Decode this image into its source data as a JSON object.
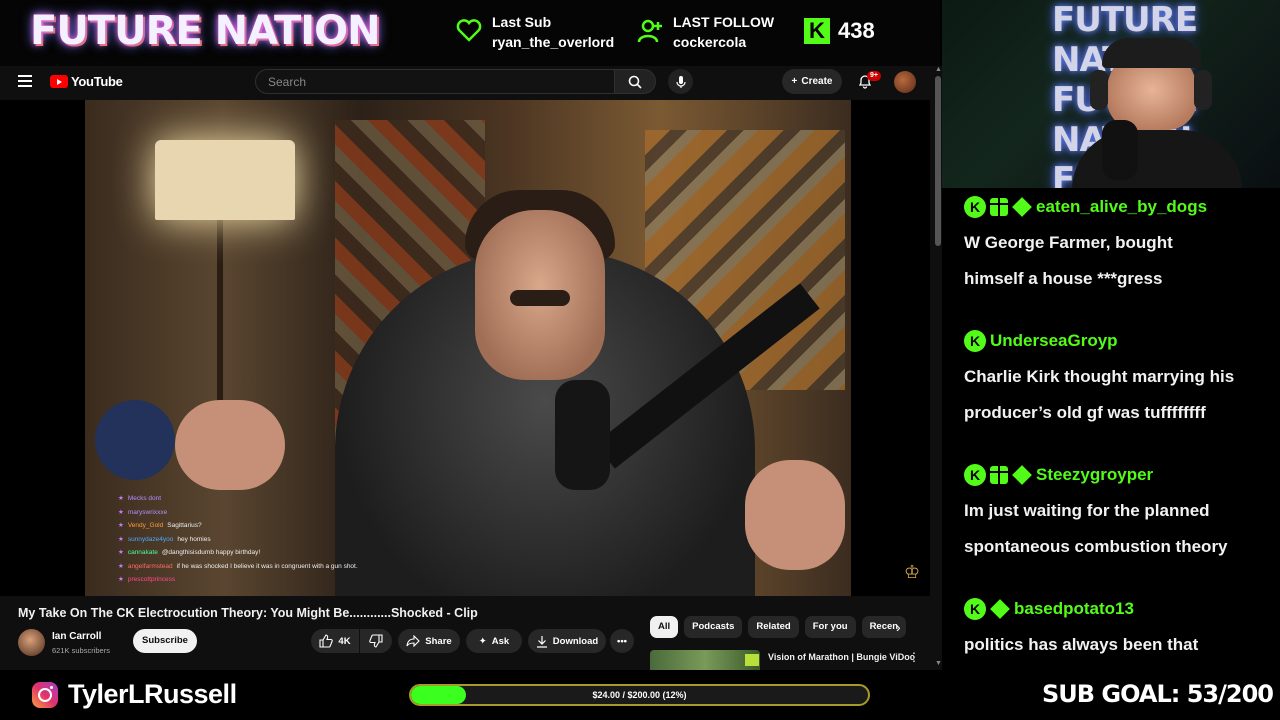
{
  "overlay": {
    "brand": "FUTURE NATION",
    "last_sub_label": "Last Sub",
    "last_sub_user": "ryan_the_overlord",
    "last_follow_label": "LAST FOLLOW",
    "last_follow_user": "cockercola",
    "kick_count": "438",
    "accent_color": "#53fc18"
  },
  "youtube": {
    "logo_text": "YouTube",
    "search_placeholder": "Search",
    "create_label": "Create",
    "notification_badge": "9+",
    "video_title": "My Take On The CK Electrocution Theory: You Might Be............Shocked - Clip",
    "channel_name": "Ian Carroll",
    "channel_subs": "621K subscribers",
    "subscribe_label": "Subscribe",
    "like_count": "4K",
    "share_label": "Share",
    "ask_label": "Ask",
    "download_label": "Download",
    "chips": [
      "All",
      "Podcasts",
      "Related",
      "For you",
      "Recen"
    ],
    "recommended_title": "Vision of Marathon | Bungie ViDoc",
    "video_chat": [
      {
        "user": "Mecks dont",
        "msg": ""
      },
      {
        "user": "maryswrixxxe",
        "msg": ""
      },
      {
        "user": "Vendy_Gold",
        "msg": "Sagittarius?"
      },
      {
        "user": "sunnydaze4yoo",
        "msg": "hey homies"
      },
      {
        "user": "cannakate",
        "msg": "@dangthisisdumb happy birthday!"
      },
      {
        "user": "angelfarmstead",
        "msg": "if he was shocked I believe it was in congruent with a gun shot."
      },
      {
        "user": "prescottprincess",
        "msg": ""
      }
    ]
  },
  "chat": {
    "messages": [
      {
        "user": "eaten_alive_by_dogs",
        "line1": "W George Farmer, bought",
        "line2": "himself a house ***gress"
      },
      {
        "user": "UnderseaGroyp",
        "line1": "Charlie Kirk thought marrying his",
        "line2": "producer’s old gf was tuffffffff"
      },
      {
        "user": "Steezygroyper",
        "line1": "Im just waiting for the planned",
        "line2": "spontaneous combustion theory"
      },
      {
        "user": "basedpotato13",
        "line1": "politics has always been that",
        "line2": ""
      }
    ]
  },
  "footer": {
    "handle": "TylerLRussell",
    "goal_text": "$24.00 / $200.00 (12%)",
    "goal_fraction": 0.12,
    "sub_goal": "SUB GOAL: 53/200"
  }
}
